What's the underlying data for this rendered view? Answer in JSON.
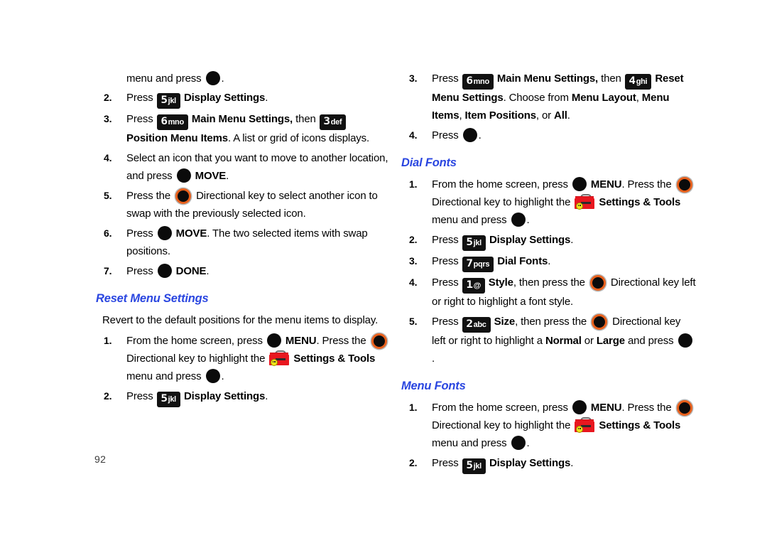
{
  "document": {
    "page_number": "92",
    "heading_color": "#2a46e0",
    "dirkey_ring_color": "#e8601c",
    "toolbox_color": "#e8171f"
  },
  "icons": {
    "ok_key": "ok-select-key-icon",
    "directional_key": "directional-key-icon",
    "settings_tools": "settings-and-tools-toolbox-icon",
    "key_5_jkl": {
      "digit": "5",
      "letters": "jkl"
    },
    "key_6_mno": {
      "digit": "6",
      "letters": "mno"
    },
    "key_3_def": {
      "digit": "3",
      "letters": "def"
    },
    "key_4_ghi": {
      "digit": "4",
      "letters": "ghi"
    },
    "key_7_pqrs": {
      "digit": "7",
      "letters": "pqrs"
    },
    "key_1_at": {
      "digit": "1",
      "letters": "@\u0001"
    },
    "key_2_abc": {
      "digit": "2",
      "letters": "abc"
    }
  },
  "left_column": {
    "continued_step": {
      "text_a": "menu and press",
      "text_b": "."
    },
    "steps_top": [
      {
        "num": "2.",
        "press": "Press",
        "key": "key_5_jkl",
        "label": "Display Settings",
        "tail": "."
      },
      {
        "num": "3.",
        "press": "Press",
        "key": "key_6_mno",
        "label": "Main Menu Settings,",
        "mid": "then",
        "key2": "key_3_def",
        "label2": "Position Menu Items",
        "tail": ". A list or grid of icons displays."
      },
      {
        "num": "4.",
        "text_a": "Select an icon that you want to move to another location, and press",
        "label": "MOVE",
        "tail": "."
      },
      {
        "num": "5.",
        "text_a": "Press the",
        "text_b": "Directional key to select another icon to swap with the previously selected icon."
      },
      {
        "num": "6.",
        "text_a": "Press",
        "label": "MOVE",
        "tail": ". The two selected items with swap positions."
      },
      {
        "num": "7.",
        "text_a": "Press",
        "label": "DONE",
        "tail": "."
      }
    ],
    "reset_menu_settings": {
      "heading": "Reset Menu Settings",
      "intro": "Revert to the default positions for the menu items to display.",
      "steps": [
        {
          "num": "1.",
          "text_a": "From the home screen, press",
          "menu_label": "MENU",
          "text_b": ". Press the",
          "text_c": "Directional key to highlight the",
          "settings_label": "Settings & Tools",
          "text_d": "menu and press",
          "text_e": "."
        },
        {
          "num": "2.",
          "press": "Press",
          "key": "key_5_jkl",
          "label": "Display Settings",
          "tail": "."
        }
      ]
    }
  },
  "right_column": {
    "steps_top": [
      {
        "num": "3.",
        "press": "Press",
        "key": "key_6_mno",
        "label": "Main Menu Settings,",
        "mid": "then",
        "key2": "key_4_ghi",
        "label2": "Reset Menu Settings",
        "tail_a": ". Choose from",
        "opt1": "Menu Layout",
        "sep1": ",",
        "opt2": "Menu Items",
        "sep2": ",",
        "opt3": "Item Positions",
        "sep3": ", or",
        "opt4": "All",
        "tail_b": "."
      },
      {
        "num": "4.",
        "press": "Press",
        "tail": "."
      }
    ],
    "dial_fonts": {
      "heading": "Dial Fonts",
      "steps": [
        {
          "num": "1.",
          "text_a": "From the home screen, press",
          "menu_label": "MENU",
          "text_b": ". Press the",
          "text_c": "Directional key to highlight the",
          "settings_label": "Settings & Tools",
          "text_d": "menu and press",
          "text_e": "."
        },
        {
          "num": "2.",
          "press": "Press",
          "key": "key_5_jkl",
          "label": "Display Settings",
          "tail": "."
        },
        {
          "num": "3.",
          "press": "Press",
          "key": "key_7_pqrs",
          "label": "Dial Fonts",
          "tail": "."
        },
        {
          "num": "4.",
          "press": "Press",
          "key": "key_1_at",
          "label": "Style",
          "text_a": ", then press the",
          "text_b": "Directional key left or right to highlight a font style."
        },
        {
          "num": "5.",
          "press": "Press",
          "key": "key_2_abc",
          "label": "Size",
          "text_a": ", then press the",
          "text_b": "Directional key left or right to highlight a",
          "opt1": "Normal",
          "text_c": "or",
          "opt2": "Large",
          "text_d": "and press",
          "tail": "."
        }
      ]
    },
    "menu_fonts": {
      "heading": "Menu Fonts",
      "steps": [
        {
          "num": "1.",
          "text_a": "From the home screen, press",
          "menu_label": "MENU",
          "text_b": ". Press the",
          "text_c": "Directional key to highlight the",
          "settings_label": "Settings & Tools",
          "text_d": "menu and press",
          "text_e": "."
        },
        {
          "num": "2.",
          "press": "Press",
          "key": "key_5_jkl",
          "label": "Display Settings",
          "tail": "."
        }
      ]
    }
  }
}
